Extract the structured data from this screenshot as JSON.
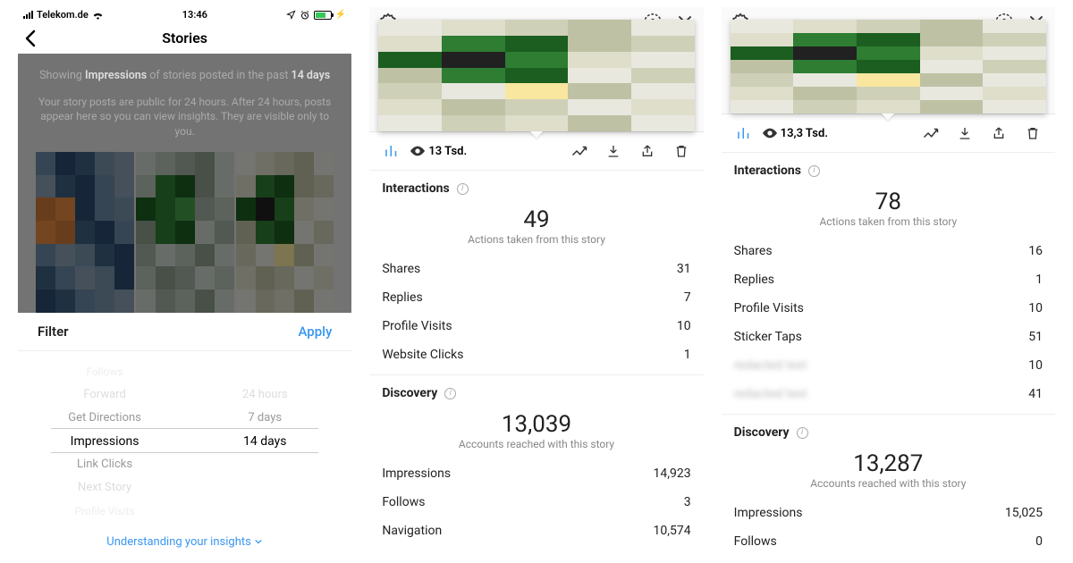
{
  "panel1": {
    "status": {
      "carrier": "Telekom.de",
      "time": "13:46"
    },
    "nav": {
      "title": "Stories"
    },
    "banner": {
      "prefix": "Showing ",
      "metric": "Impressions",
      "mid": " of stories posted in the past ",
      "range": "14 days",
      "detail": "Your story posts are public for 24 hours. After 24 hours, posts appear here so you can view insights. They are visible only to you."
    },
    "filter": {
      "label": "Filter",
      "apply": "Apply"
    },
    "picker_left": {
      "ghost1": "Follows",
      "far": "Forward",
      "near": "Get Directions",
      "sel": "Impressions",
      "near2": "Link Clicks",
      "far2": "Next Story",
      "ghost2": "Profile Visits"
    },
    "picker_right": {
      "far": "24 hours",
      "near": "7 days",
      "sel": "14 days"
    },
    "footer_link": "Understanding your insights"
  },
  "panel2": {
    "views_short": "13 Tsd.",
    "interactions": {
      "title": "Interactions",
      "big": "49",
      "caption": "Actions taken from this story",
      "rows": [
        {
          "label": "Shares",
          "value": "31"
        },
        {
          "label": "Replies",
          "value": "7"
        },
        {
          "label": "Profile Visits",
          "value": "10"
        },
        {
          "label": "Website Clicks",
          "value": "1"
        }
      ]
    },
    "discovery": {
      "title": "Discovery",
      "big": "13,039",
      "caption": "Accounts reached with this story",
      "rows": [
        {
          "label": "Impressions",
          "value": "14,923"
        },
        {
          "label": "Follows",
          "value": "3"
        },
        {
          "label": "Navigation",
          "value": "10,574"
        }
      ]
    }
  },
  "panel3": {
    "views_short": "13,3 Tsd.",
    "interactions": {
      "title": "Interactions",
      "big": "78",
      "caption": "Actions taken from this story",
      "rows": [
        {
          "label": "Shares",
          "value": "16"
        },
        {
          "label": "Replies",
          "value": "1"
        },
        {
          "label": "Profile Visits",
          "value": "10"
        },
        {
          "label": "Sticker Taps",
          "value": "51"
        }
      ],
      "blurred": [
        {
          "value": "10"
        },
        {
          "value": "41"
        }
      ]
    },
    "discovery": {
      "title": "Discovery",
      "big": "13,287",
      "caption": "Accounts reached with this story",
      "rows": [
        {
          "label": "Impressions",
          "value": "15,025"
        },
        {
          "label": "Follows",
          "value": "0"
        }
      ]
    }
  },
  "pixel_colors_a": [
    "#6b8aa8",
    "#2b4d6f",
    "#3d5f80",
    "#7893ab",
    "#8aa0b5",
    "#8aa0b5",
    "#3d5f80",
    "#2b4d6f",
    "#6b8aa8",
    "#8aa0b5",
    "#d07a3a",
    "#e68a3f",
    "#2b4d6f",
    "#6b8aa8",
    "#7893ab",
    "#e68a3f",
    "#d07a3a",
    "#3d5f80",
    "#2b4d6f",
    "#6b8aa8",
    "#6b8aa8",
    "#8aa0b5",
    "#7893ab",
    "#3d5f80",
    "#2b4d6f",
    "#3d5f80",
    "#6b8aa8",
    "#8aa0b5",
    "#7893ab",
    "#2b4d6f",
    "#2b4d6f",
    "#3d5f80",
    "#6b8aa8",
    "#7893ab",
    "#8aa0b5"
  ],
  "pixel_colors_b": [
    "#cfd7cf",
    "#b9c3b9",
    "#a3b1a3",
    "#8f9f8f",
    "#cfd7cf",
    "#b9c3b9",
    "#2e7d32",
    "#1b5e20",
    "#8f9f8f",
    "#cfd7cf",
    "#1b5e20",
    "#2e7d32",
    "#43a047",
    "#a3b1a3",
    "#b9c3b9",
    "#8f9f8f",
    "#2e7d32",
    "#1b5e20",
    "#cfd7cf",
    "#a3b1a3",
    "#a3b1a3",
    "#cfd7cf",
    "#b9c3b9",
    "#8f9f8f",
    "#cfd7cf",
    "#b9c3b9",
    "#8f9f8f",
    "#a3b1a3",
    "#cfd7cf",
    "#b9c3b9",
    "#cfd7cf",
    "#a3b1a3",
    "#b9c3b9",
    "#8f9f8f",
    "#cfd7cf"
  ],
  "pixel_colors_c": [
    "#e8e8df",
    "#dedecb",
    "#cfd0b8",
    "#bfc1a4",
    "#e8e8df",
    "#dedecb",
    "#2e7d32",
    "#1b5e20",
    "#bfc1a4",
    "#cfd0b8",
    "#1b5e20",
    "#212121",
    "#2e7d32",
    "#dedecb",
    "#e8e8df",
    "#bfc1a4",
    "#2e7d32",
    "#1b5e20",
    "#e8e8df",
    "#cfd0b8",
    "#cfd0b8",
    "#e8e8df",
    "#f9e79f",
    "#bfc1a4",
    "#e8e8df",
    "#dedecb",
    "#bfc1a4",
    "#cfd0b8",
    "#e8e8df",
    "#dedecb",
    "#e8e8df",
    "#cfd0b8",
    "#dedecb",
    "#bfc1a4",
    "#e8e8df"
  ]
}
